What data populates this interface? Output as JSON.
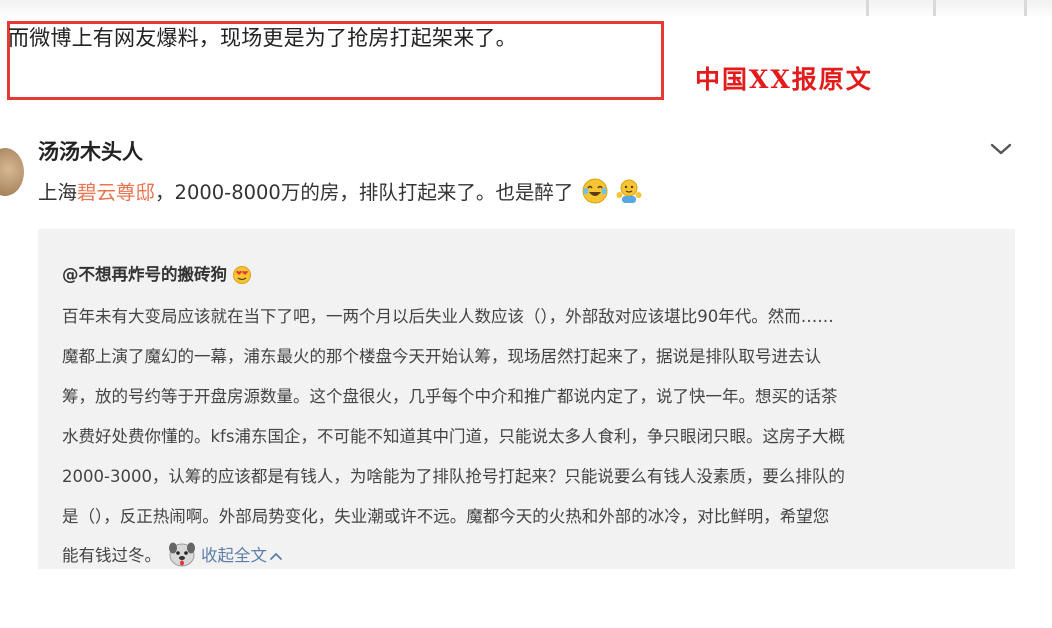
{
  "caption": {
    "quote": "而微博上有网友爆料，现场更是为了抢房打起架来了。",
    "source_label": "中国XX报原文"
  },
  "post": {
    "author": "汤汤木头人",
    "text_prefix": "上海",
    "link_text": "碧云尊邸",
    "text_suffix": "，2000-8000万的房，排队打起来了。也是醉了",
    "icons": [
      "avatar",
      "chevron-down-icon",
      "laughing-crying-emoji",
      "shrug-emoji"
    ]
  },
  "repost": {
    "author": "@不想再炸号的搬砖狗",
    "lines": [
      "百年未有大变局应该就在当下了吧，一两个月以后失业人数应该（），外部敌对应该堪比90年代。然而……",
      "魔都上演了魔幻的一幕，浦东最火的那个楼盘今天开始认筹，现场居然打起来了，据说是排队取号进去认",
      "筹，放的号约等于开盘房源数量。这个盘很火，几乎每个中介和推广都说内定了，说了快一年。想买的话茶",
      "水费好处费你懂的。kfs浦东国企，不可能不知道其中门道，只能说太多人食利，争只眼闭只眼。这房子大概",
      "2000-3000，认筹的应该都是有钱人，为啥能为了排队抢号打起来？只能说要么有钱人没素质，要么排队的",
      "是（），反正热闹啊。外部局势变化，失业潮或许不远。魔都今天的火热和外部的冰冷，对比鲜明，希望您"
    ],
    "last_line": "能有钱过冬。",
    "collapse_label": "收起全文",
    "icons": [
      "heart-eyes-emoji",
      "dog-emoji",
      "chevron-up-icon"
    ]
  },
  "colors": {
    "highlight_border": "#e53935",
    "source_label": "#e31b1b",
    "link": "#eb7350",
    "collapse_link": "#5d7fa8",
    "repost_background": "#f2f2f2"
  }
}
